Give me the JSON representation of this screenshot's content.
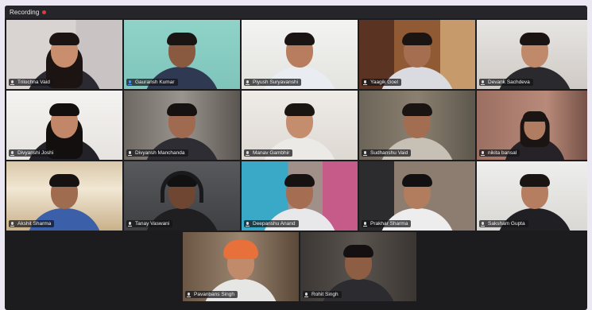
{
  "recording": {
    "label": "Recording",
    "dot_color": "#e0393e"
  },
  "participants": [
    {
      "name": "Trilochna Vaid",
      "mic": "muted"
    },
    {
      "name": "Gauransh Kumar",
      "mic": "active"
    },
    {
      "name": "Piyush Suryavanshi",
      "mic": "muted"
    },
    {
      "name": "Yaagik Goel",
      "mic": "muted"
    },
    {
      "name": "Devank Sachdeva",
      "mic": "muted"
    },
    {
      "name": "Divyanshi Joshi",
      "mic": "muted"
    },
    {
      "name": "Divyansh Manchanda",
      "mic": "muted"
    },
    {
      "name": "Manav Gambhir",
      "mic": "muted"
    },
    {
      "name": "Sudhanshu Vaid",
      "mic": "muted"
    },
    {
      "name": "nikita bansal",
      "mic": "muted"
    },
    {
      "name": "Akshit Sharma",
      "mic": "muted"
    },
    {
      "name": "Tanay Vaswani",
      "mic": "muted"
    },
    {
      "name": "Deepanshu Anand",
      "mic": "muted"
    },
    {
      "name": "Prakhar Sharma",
      "mic": "muted"
    },
    {
      "name": "Saksham Gupta",
      "mic": "muted"
    },
    {
      "name": "Pavanbans Singh",
      "mic": "muted"
    },
    {
      "name": "Rohit Singh",
      "mic": "muted"
    }
  ],
  "colors": {
    "active_mic": "#4a8cff",
    "background": "#1c1c1e"
  }
}
